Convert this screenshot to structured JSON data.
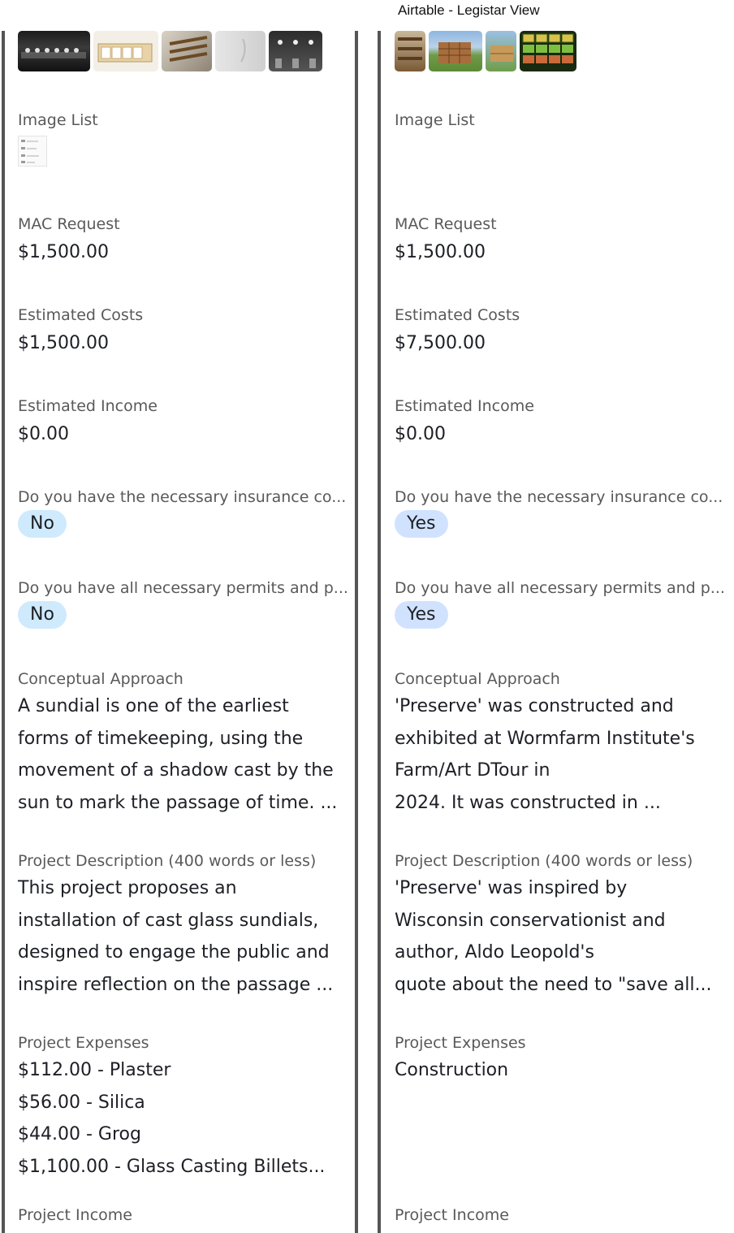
{
  "header": {
    "title": "Airtable - Legistar View"
  },
  "labels": {
    "image_list": "Image List",
    "mac_request": "MAC Request",
    "estimated_costs": "Estimated Costs",
    "estimated_income": "Estimated Income",
    "insurance": "Do you have the necessary insurance co...",
    "permits": "Do you have all necessary permits and p...",
    "conceptual": "Conceptual Approach",
    "description": "Project Description (400 words or less)",
    "expenses": "Project Expenses",
    "income": "Project Income"
  },
  "records": [
    {
      "mac_request": "$1,500.00",
      "estimated_costs": "$1,500.00",
      "estimated_income": "$0.00",
      "insurance": "No",
      "permits": "No",
      "conceptual": "A sundial is one of the earliest\nforms of timekeeping, using the\nmovement of a shadow cast by the\nsun to mark the passage of time. ...",
      "description": "This project proposes an\ninstallation of cast glass sundials,\ndesigned to engage the public and\ninspire reflection on the passage ...",
      "expenses": "$112.00 - Plaster\n$56.00 - Silica\n$44.00 - Grog\n$1,100.00 - Glass Casting Billets..."
    },
    {
      "mac_request": "$1,500.00",
      "estimated_costs": "$7,500.00",
      "estimated_income": "$0.00",
      "insurance": "Yes",
      "permits": "Yes",
      "conceptual": "'Preserve' was constructed and\nexhibited at Wormfarm Institute's\nFarm/Art DTour in\n2024. It was constructed in ...",
      "description": "'Preserve' was inspired by\nWisconsin conservationist and\nauthor, Aldo Leopold's\nquote about the need to \"save all...",
      "expenses": "Construction"
    }
  ],
  "colors": {
    "pill_no": "#cfeafd",
    "pill_yes": "#d1e2ff",
    "divider": "#555555"
  }
}
